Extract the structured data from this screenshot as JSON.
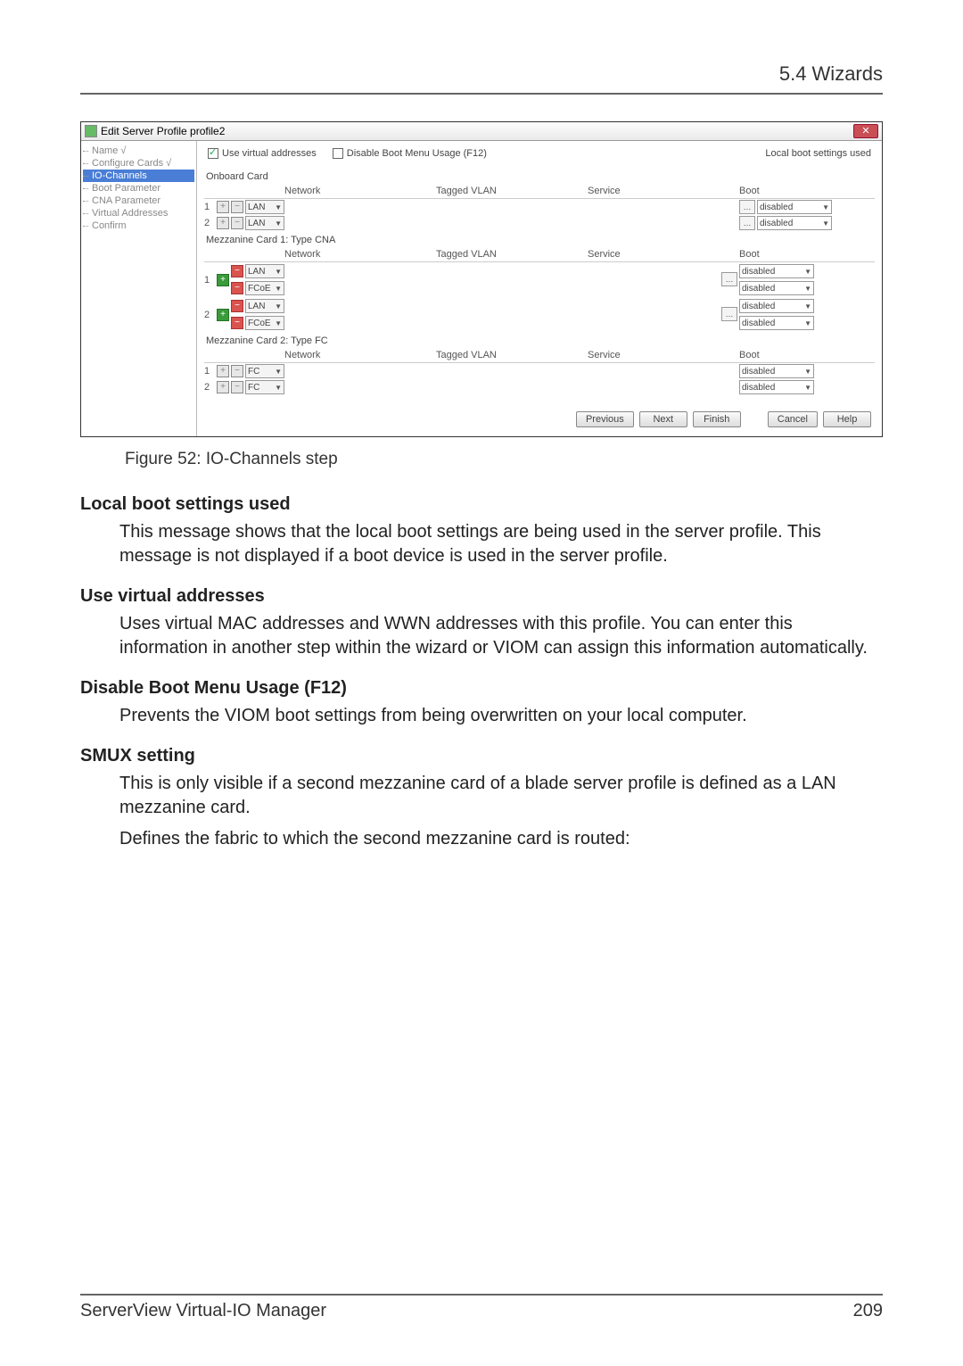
{
  "header": {
    "section": "5.4 Wizards"
  },
  "window": {
    "title": "Edit Server Profile profile2",
    "sidebar": {
      "items": [
        {
          "label": "Name √"
        },
        {
          "label": "Configure Cards √"
        },
        {
          "label": "IO-Channels",
          "selected": true
        },
        {
          "label": "Boot Parameter"
        },
        {
          "label": "CNA Parameter"
        },
        {
          "label": "Virtual Addresses"
        },
        {
          "label": "Confirm"
        }
      ]
    },
    "top": {
      "use_virtual_label": "Use virtual addresses",
      "disable_boot_label": "Disable Boot Menu Usage (F12)",
      "local_boot_label": "Local boot settings used"
    },
    "columns": {
      "network": "Network",
      "tagged_vlan": "Tagged VLAN",
      "service": "Service",
      "boot": "Boot"
    },
    "cards": {
      "onboard": {
        "title": "Onboard Card",
        "rows": [
          {
            "num": "1",
            "type": "LAN",
            "boot": "disabled",
            "show_dots": true
          },
          {
            "num": "2",
            "type": "LAN",
            "boot": "disabled",
            "show_dots": true
          }
        ]
      },
      "mezz1": {
        "title": "Mezzanine Card 1: Type CNA",
        "rows": [
          {
            "num": "1",
            "lines": [
              {
                "type": "LAN",
                "boot": "disabled"
              },
              {
                "type": "FCoE",
                "boot": "disabled"
              }
            ]
          },
          {
            "num": "2",
            "lines": [
              {
                "type": "LAN",
                "boot": "disabled"
              },
              {
                "type": "FCoE",
                "boot": "disabled"
              }
            ]
          }
        ]
      },
      "mezz2": {
        "title": "Mezzanine Card 2: Type FC",
        "rows": [
          {
            "num": "1",
            "type": "FC",
            "boot": "disabled",
            "show_dots": false
          },
          {
            "num": "2",
            "type": "FC",
            "boot": "disabled",
            "show_dots": false
          }
        ]
      }
    },
    "buttons": {
      "previous": "Previous",
      "next": "Next",
      "finish": "Finish",
      "cancel": "Cancel",
      "help": "Help"
    }
  },
  "caption": "Figure 52: IO-Channels step",
  "doc": {
    "t1": "Local boot settings used",
    "d1": "This message shows that the local boot settings are being used in the server profile. This message is not displayed if a boot device is used in the server profile.",
    "t2": "Use virtual addresses",
    "d2": "Uses virtual MAC addresses and WWN addresses with this profile. You can enter this information in another step within the wizard or VIOM can assign this information automatically.",
    "t3": "Disable Boot Menu Usage (F12)",
    "d3": "Prevents the VIOM boot settings from being overwritten on your local computer.",
    "t4": "SMUX setting",
    "d4a": "This is only visible if a second mezzanine card of a blade server profile is defined as a LAN mezzanine card.",
    "d4b": "Defines the fabric to which the second mezzanine card is routed:"
  },
  "footer": {
    "left": "ServerView Virtual-IO Manager",
    "right": "209"
  }
}
